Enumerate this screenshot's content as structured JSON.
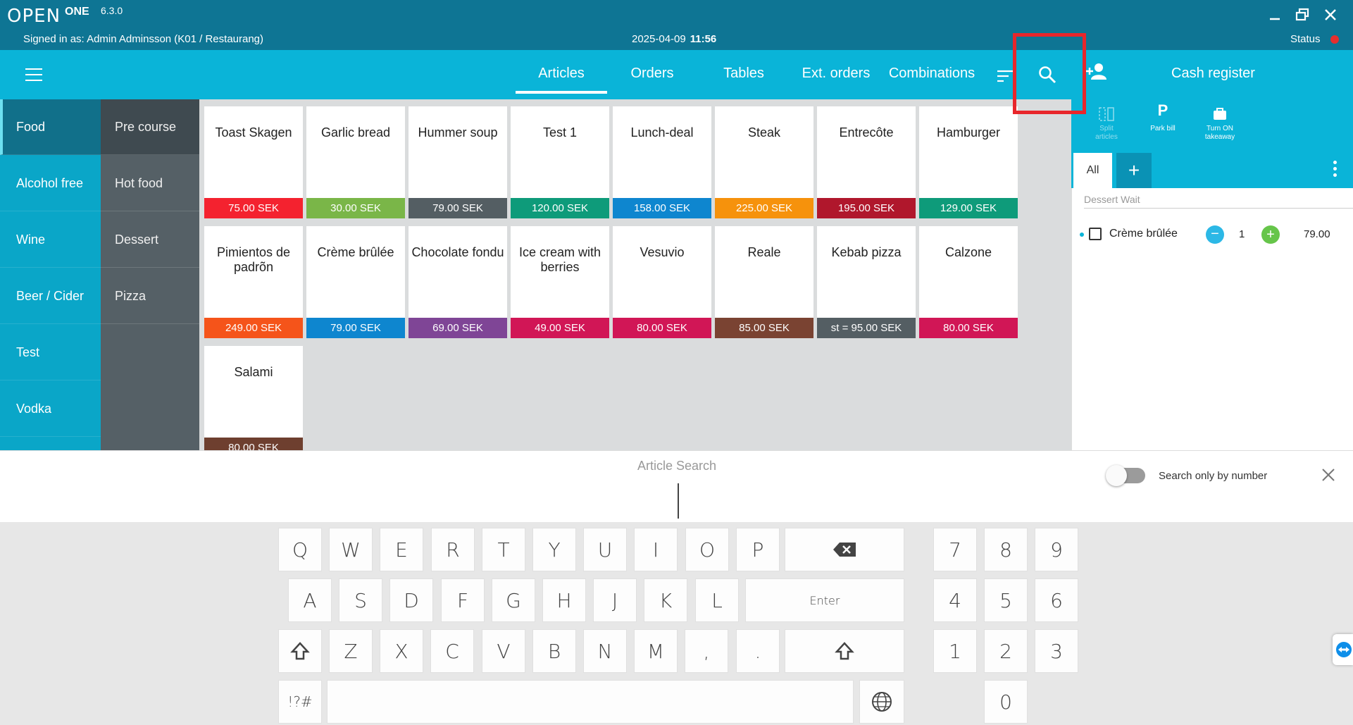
{
  "titlebar": {
    "logo": "OPEN",
    "logo_suffix": "ONE",
    "version": "6.3.0",
    "signed_in": "Signed in as: Admin Adminsson (K01 / Restaurang)",
    "date": "2025-04-09",
    "time": "11:56",
    "status_label": "Status",
    "status_color": "#e62e2e"
  },
  "nav": {
    "tabs": [
      "Articles",
      "Orders",
      "Tables",
      "Ext. orders",
      "Combinations"
    ],
    "active_tab": "Articles"
  },
  "register": {
    "title": "Cash register",
    "actions": [
      {
        "label_line1": "Split",
        "label_line2": "articles",
        "icon": "split-icon",
        "enabled": false
      },
      {
        "label_line1": "Park bill",
        "label_line2": "",
        "icon": "park-icon",
        "enabled": true
      },
      {
        "label_line1": "Turn ON",
        "label_line2": "takeaway",
        "icon": "bag-icon",
        "enabled": true
      }
    ],
    "tab_all": "All",
    "tab_add": "+",
    "group_label": "Dessert Wait",
    "order_items": [
      {
        "name": "Crème brûlée",
        "qty": "1",
        "price": "79.00"
      }
    ]
  },
  "categories": [
    "Food",
    "Alcohol free",
    "Wine",
    "Beer / Cider",
    "Test",
    "Vodka"
  ],
  "active_category": "Food",
  "subcategories": [
    "Pre course",
    "Hot food",
    "Dessert",
    "Pizza"
  ],
  "active_subcategory": "Pre course",
  "articles": [
    {
      "name": "Toast Skagen",
      "price": "75.00 SEK",
      "color": "#f4222f"
    },
    {
      "name": "Garlic bread",
      "price": "30.00 SEK",
      "color": "#7ab648"
    },
    {
      "name": "Hummer soup",
      "price": "79.00 SEK",
      "color": "#545e63"
    },
    {
      "name": "Test 1",
      "price": "120.00 SEK",
      "color": "#0e9b7a"
    },
    {
      "name": "Lunch-deal",
      "price": "158.00 SEK",
      "color": "#0e86cf"
    },
    {
      "name": "Steak",
      "price": "225.00 SEK",
      "color": "#f6920c"
    },
    {
      "name": "Entrecôte",
      "price": "195.00 SEK",
      "color": "#b0172c"
    },
    {
      "name": "Hamburger",
      "price": "129.00 SEK",
      "color": "#0e9b7a"
    },
    {
      "name": "Pimientos de padrõn",
      "price": "249.00 SEK",
      "color": "#f5541a"
    },
    {
      "name": "Crème brûlée",
      "price": "79.00 SEK",
      "color": "#0e86cf"
    },
    {
      "name": "Chocolate fondu",
      "price": "69.00 SEK",
      "color": "#7f4596"
    },
    {
      "name": "Ice cream with berries",
      "price": "49.00 SEK",
      "color": "#d11656"
    },
    {
      "name": "Vesuvio",
      "price": "80.00 SEK",
      "color": "#d11656"
    },
    {
      "name": "Reale",
      "price": "85.00 SEK",
      "color": "#7a4332"
    },
    {
      "name": "Kebab pizza",
      "price": "st = 95.00 SEK",
      "color": "#545e63"
    },
    {
      "name": "Calzone",
      "price": "80.00 SEK",
      "color": "#d11656"
    },
    {
      "name": "Salami",
      "price": "80.00 SEK",
      "color": "#6e3f2f"
    }
  ],
  "search": {
    "label": "Article Search",
    "toggle_label": "Search only by number",
    "toggle_on": false
  },
  "keyboard": {
    "row1": [
      "Q",
      "W",
      "E",
      "R",
      "T",
      "Y",
      "U",
      "I",
      "O",
      "P"
    ],
    "row2": [
      "A",
      "S",
      "D",
      "F",
      "G",
      "H",
      "J",
      "K",
      "L"
    ],
    "row3": [
      "Z",
      "X",
      "C",
      "V",
      "B",
      "N",
      "M",
      ",",
      "."
    ],
    "enter": "Enter",
    "symbols": "!?#",
    "numpad": [
      "7",
      "8",
      "9",
      "4",
      "5",
      "6",
      "1",
      "2",
      "3",
      "0"
    ]
  }
}
